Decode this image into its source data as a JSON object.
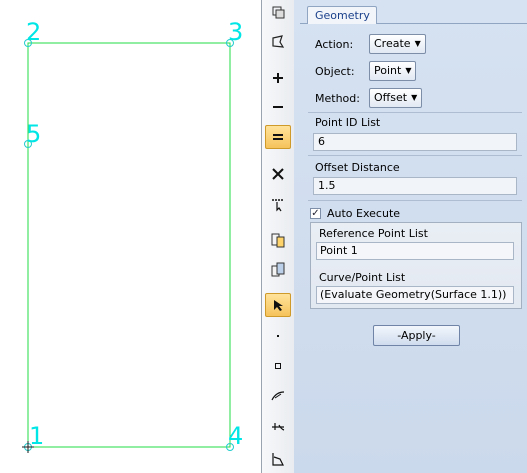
{
  "viewport": {
    "point_labels": [
      "2",
      "3",
      "5",
      "1",
      "4"
    ],
    "colors": {
      "geometry_line": "#22dd44",
      "point_label": "#00e5e5"
    }
  },
  "toolbar": {
    "icons": [
      "view-settings-icon",
      "curve-select-icon",
      "zoom-in-icon",
      "zoom-out-icon",
      "fit-view-icon",
      "delete-icon",
      "pick-filter-icon",
      "copy-to-icon",
      "paste-to-icon",
      "select-arrow-icon",
      "point-icon",
      "node-icon",
      "curve-tool-icon",
      "vector-icon",
      "surface-icon"
    ]
  },
  "panel": {
    "tab_label": "Geometry",
    "action": {
      "label": "Action:",
      "value": "Create"
    },
    "object": {
      "label": "Object:",
      "value": "Point"
    },
    "method": {
      "label": "Method:",
      "value": "Offset"
    },
    "point_id_list": {
      "label": "Point ID List",
      "value": "6"
    },
    "offset_distance": {
      "label": "Offset Distance",
      "value": "1.5"
    },
    "auto_execute": {
      "label": "Auto Execute",
      "checked": true,
      "mark": "✓"
    },
    "reference_point_list": {
      "label": "Reference Point List",
      "value": "Point 1"
    },
    "curve_point_list": {
      "label": "Curve/Point List",
      "value": "(Evaluate Geometry(Surface 1.1))"
    },
    "apply_label": "-Apply-",
    "colors": {
      "panel_bg": "#d0ddee",
      "active_tool": "#f6c35c"
    }
  }
}
